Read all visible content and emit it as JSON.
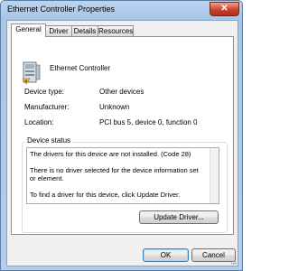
{
  "window": {
    "title": "Ethernet Controller Properties",
    "close_symbol": "✕"
  },
  "tabs": [
    {
      "label": "General",
      "active": true
    },
    {
      "label": "Driver",
      "active": false
    },
    {
      "label": "Details",
      "active": false
    },
    {
      "label": "Resources",
      "active": false
    }
  ],
  "device": {
    "icon": "network-adapter-icon",
    "name": "Ethernet Controller",
    "properties": [
      {
        "label": "Device type:",
        "value": "Other devices"
      },
      {
        "label": "Manufacturer:",
        "value": "Unknown"
      },
      {
        "label": "Location:",
        "value": "PCI bus 5, device 0, function 0"
      }
    ]
  },
  "status": {
    "legend": "Device status",
    "text": "The drivers for this device are not installed. (Code 28)\n\nThere is no driver selected for the device information set or element.\n\nTo find a driver for this device, click Update Driver."
  },
  "buttons": {
    "update_driver": "Update Driver...",
    "ok": "OK",
    "cancel": "Cancel"
  },
  "colors": {
    "title_bar": "#b5cdea",
    "close_button": "#c9432b"
  }
}
